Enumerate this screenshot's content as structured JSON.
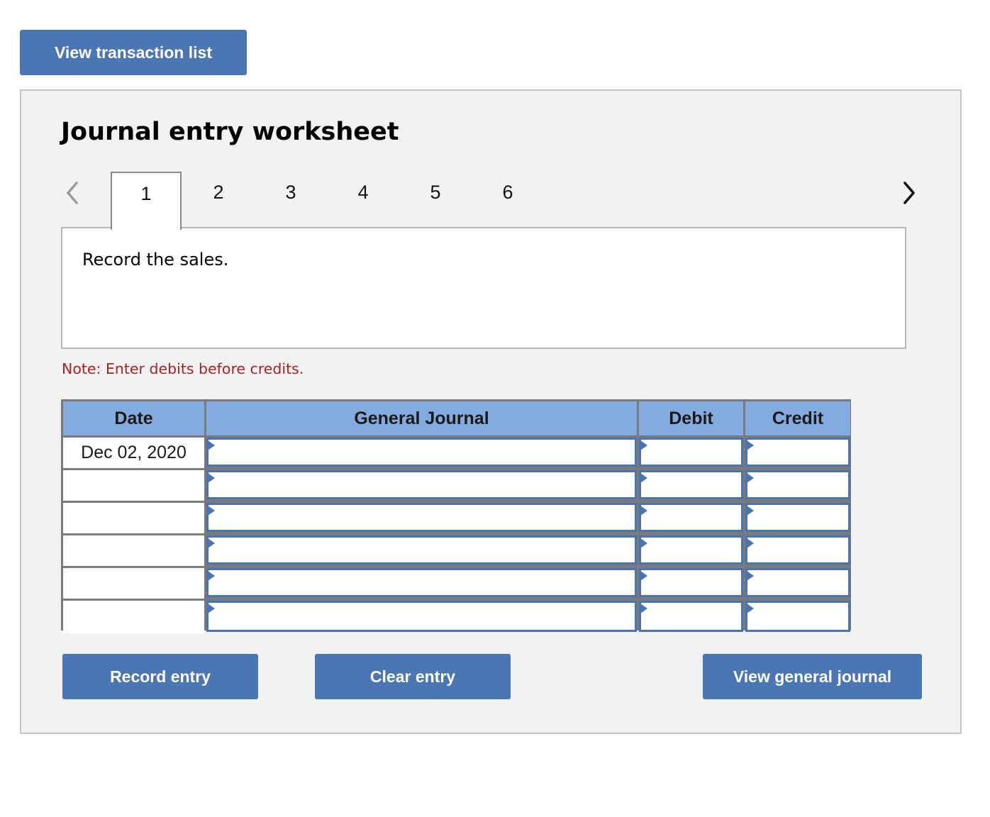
{
  "top_button": {
    "label": "View transaction list"
  },
  "worksheet": {
    "title": "Journal entry worksheet",
    "nav": {
      "prev_icon": "chevron-left-icon",
      "next_icon": "chevron-right-icon"
    },
    "tabs": [
      {
        "label": "1",
        "active": true
      },
      {
        "label": "2",
        "active": false
      },
      {
        "label": "3",
        "active": false
      },
      {
        "label": "4",
        "active": false
      },
      {
        "label": "5",
        "active": false
      },
      {
        "label": "6",
        "active": false
      }
    ],
    "prompt": "Record the sales.",
    "note": "Note: Enter debits before credits.",
    "table": {
      "headers": {
        "date": "Date",
        "account": "General Journal",
        "debit": "Debit",
        "credit": "Credit"
      },
      "rows": [
        {
          "date": "Dec 02, 2020",
          "account": "",
          "debit": "",
          "credit": ""
        },
        {
          "date": "",
          "account": "",
          "debit": "",
          "credit": ""
        },
        {
          "date": "",
          "account": "",
          "debit": "",
          "credit": ""
        },
        {
          "date": "",
          "account": "",
          "debit": "",
          "credit": ""
        },
        {
          "date": "",
          "account": "",
          "debit": "",
          "credit": ""
        },
        {
          "date": "",
          "account": "",
          "debit": "",
          "credit": ""
        }
      ]
    },
    "buttons": {
      "record": "Record entry",
      "clear": "Clear entry",
      "view_general_journal": "View general journal"
    }
  },
  "colors": {
    "button_blue": "#4a76b4",
    "header_blue": "#83abdf",
    "note_red": "#a52323",
    "panel_bg": "#f2f2f2"
  }
}
